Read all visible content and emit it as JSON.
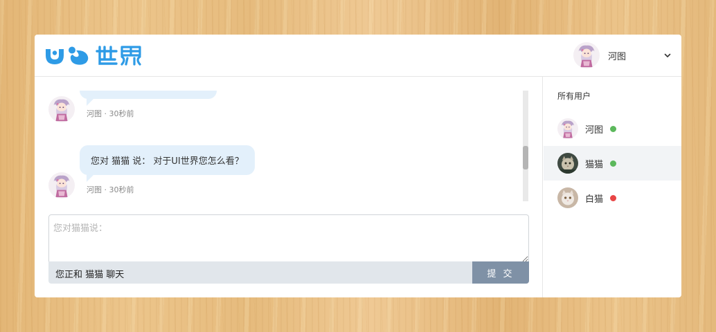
{
  "brand": {
    "logo_text": "UI世界",
    "color": "#2e9be6"
  },
  "header": {
    "current_user": "河图"
  },
  "chat": {
    "messages": [
      {
        "sender": "河图",
        "text": "",
        "meta": "河图 · 30秒前"
      },
      {
        "sender": "河图",
        "text": "您对 猫猫 说： 对于UI世界您怎么看？",
        "meta": "河图 · 30秒前"
      }
    ],
    "composer": {
      "placeholder": "您对猫猫说：",
      "status": "您正和 猫猫 聊天",
      "submit_label": "提 交"
    }
  },
  "sidebar": {
    "title": "所有用户",
    "users": [
      {
        "name": "河图",
        "status": "online",
        "status_color": "#5cb85c"
      },
      {
        "name": "猫猫",
        "status": "online",
        "status_color": "#5cb85c",
        "active": true
      },
      {
        "name": "白猫",
        "status": "offline",
        "status_color": "#e84545"
      }
    ]
  }
}
